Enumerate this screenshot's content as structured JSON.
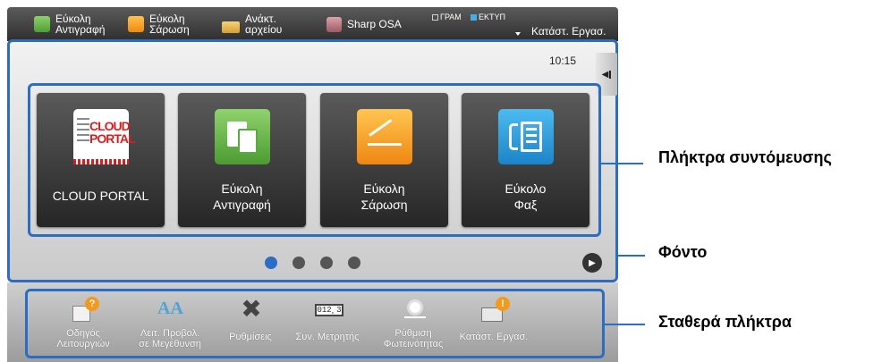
{
  "top_bar": {
    "items": [
      {
        "label": "Εύκολη\nΑντιγραφή",
        "icon": "copy-icon"
      },
      {
        "label": "Εύκολη\nΣάρωση",
        "icon": "scan-icon"
      },
      {
        "label": "Ανάκτ.\nαρχείου",
        "icon": "folder-icon"
      },
      {
        "label": "Sharp OSA",
        "icon": "osa-icon"
      }
    ],
    "indicator_print": "ΓΡΑΜ",
    "indicator_fax": "ΕΚΤΥΠ",
    "job_status": "Κατάστ. Εργασ."
  },
  "main": {
    "clock": "10:15",
    "side_tab": "◀",
    "shortcut_keys": [
      {
        "label": "CLOUD PORTAL",
        "icon_text": "CLOUD\nPORTAL",
        "icon": "cloud-portal-icon"
      },
      {
        "label": "Εύκολη\nΑντιγραφή",
        "icon": "copy-icon"
      },
      {
        "label": "Εύκολη\nΣάρωση",
        "icon": "scan-icon"
      },
      {
        "label": "Εύκολο\nΦαξ",
        "icon": "fax-icon"
      }
    ],
    "page_count": 4,
    "active_page": 1,
    "next_button": "▶"
  },
  "fixed_keys": [
    {
      "label": "Οδηγός\nΛειτουργιών",
      "icon": "guide-icon"
    },
    {
      "label": "Λειτ. Προβολ.\nσε Μεγέθυνση",
      "icon": "zoom-display-icon",
      "icon_text": "AA"
    },
    {
      "label": "Ρυθμίσεις",
      "icon": "settings-icon"
    },
    {
      "label": "Συν. Μετρητής",
      "icon": "counter-icon",
      "icon_text": "012¸3"
    },
    {
      "label": "Ρύθμιση\nΦωτεινότητας",
      "icon": "brightness-icon"
    },
    {
      "label": "Κατάστ. Εργασ.",
      "icon": "job-status-icon"
    }
  ],
  "callouts": {
    "shortcut_keys": "Πλήκτρα συντόμευσης",
    "background": "Φόντο",
    "fixed_keys": "Σταθερά πλήκτρα"
  },
  "colors": {
    "highlight_border": "#2b6cc4",
    "key_background": "#3a3a3a"
  }
}
